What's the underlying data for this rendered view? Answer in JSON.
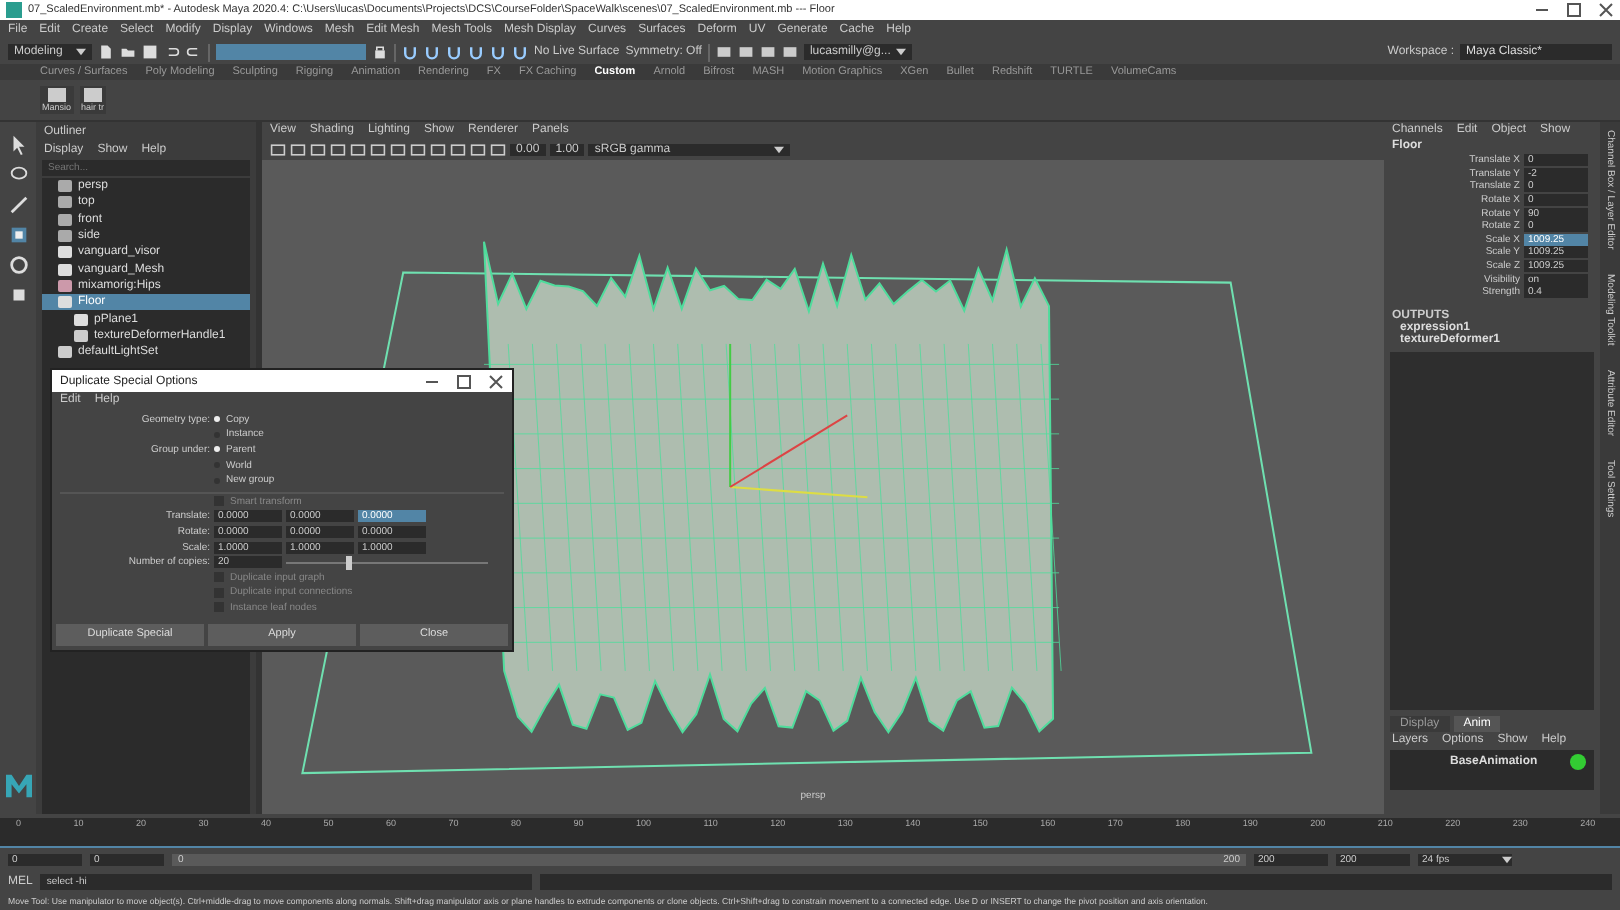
{
  "window": {
    "title": "07_ScaledEnvironment.mb* - Autodesk Maya 2020.4: C:\\Users\\lucas\\Documents\\Projects\\DCS\\CourseFolder\\SpaceWalk\\scenes\\07_ScaledEnvironment.mb --- Floor"
  },
  "menu_bar": [
    "File",
    "Edit",
    "Create",
    "Select",
    "Modify",
    "Display",
    "Windows",
    "Mesh",
    "Edit Mesh",
    "Mesh Tools",
    "Mesh Display",
    "Curves",
    "Surfaces",
    "Deform",
    "UV",
    "Generate",
    "Cache",
    "Help"
  ],
  "toolbar": {
    "mode": "Modeling",
    "live_surface": "No Live Surface",
    "symmetry": "Symmetry: Off",
    "account": "lucasmilly@g...",
    "workspace_label": "Workspace :",
    "workspace": "Maya Classic*"
  },
  "shelf_tabs": [
    {
      "label": "Curves / Surfaces",
      "selected": false
    },
    {
      "label": "Poly Modeling",
      "selected": false
    },
    {
      "label": "Sculpting",
      "selected": false
    },
    {
      "label": "Rigging",
      "selected": false
    },
    {
      "label": "Animation",
      "selected": false
    },
    {
      "label": "Rendering",
      "selected": false
    },
    {
      "label": "FX",
      "selected": false
    },
    {
      "label": "FX Caching",
      "selected": false
    },
    {
      "label": "Custom",
      "selected": true
    },
    {
      "label": "Arnold",
      "selected": false
    },
    {
      "label": "Bifrost",
      "selected": false
    },
    {
      "label": "MASH",
      "selected": false
    },
    {
      "label": "Motion Graphics",
      "selected": false
    },
    {
      "label": "XGen",
      "selected": false
    },
    {
      "label": "Bullet",
      "selected": false
    },
    {
      "label": "Redshift",
      "selected": false
    },
    {
      "label": "TURTLE",
      "selected": false
    },
    {
      "label": "VolumeCams",
      "selected": false
    }
  ],
  "shelf_items": [
    "Mansio",
    "hair tr"
  ],
  "outliner": {
    "title": "Outliner",
    "menu": [
      "Display",
      "Show",
      "Help"
    ],
    "search": {
      "placeholder": "Search..."
    },
    "items": [
      {
        "label": "persp",
        "kind": "camera",
        "selected": false
      },
      {
        "label": "top",
        "kind": "camera",
        "selected": false
      },
      {
        "label": "front",
        "kind": "camera",
        "selected": false
      },
      {
        "label": "side",
        "kind": "camera",
        "selected": false
      },
      {
        "label": "vanguard_visor",
        "kind": "mesh",
        "selected": false
      },
      {
        "label": "vanguard_Mesh",
        "kind": "mesh",
        "selected": false
      },
      {
        "label": "mixamorig:Hips",
        "kind": "joint",
        "selected": false
      },
      {
        "label": "Floor",
        "kind": "mesh",
        "selected": true,
        "children": [
          {
            "label": "pPlane1",
            "kind": "mesh",
            "selected": false
          },
          {
            "label": "textureDeformerHandle1",
            "kind": "deformer",
            "selected": false
          }
        ]
      },
      {
        "label": "defaultLightSet",
        "kind": "set",
        "selected": false
      }
    ]
  },
  "viewport": {
    "menu": [
      "View",
      "Shading",
      "Lighting",
      "Show",
      "Renderer",
      "Panels"
    ],
    "exposure": "0.00",
    "gamma": "1.00",
    "color_space": "sRGB gamma",
    "camera": "persp"
  },
  "channel_box": {
    "menu": [
      "Channels",
      "Edit",
      "Object",
      "Show"
    ],
    "object": "Floor",
    "attributes": [
      {
        "name": "Translate X",
        "value": "0",
        "selected": false
      },
      {
        "name": "Translate Y",
        "value": "-2",
        "selected": false
      },
      {
        "name": "Translate Z",
        "value": "0",
        "selected": false
      },
      {
        "name": "Rotate X",
        "value": "0",
        "selected": false
      },
      {
        "name": "Rotate Y",
        "value": "90",
        "selected": false
      },
      {
        "name": "Rotate Z",
        "value": "0",
        "selected": false
      },
      {
        "name": "Scale X",
        "value": "1009.25",
        "selected": true
      },
      {
        "name": "Scale Y",
        "value": "1009.25",
        "selected": false
      },
      {
        "name": "Scale Z",
        "value": "1009.25",
        "selected": false
      },
      {
        "name": "Visibility",
        "value": "on",
        "selected": false
      },
      {
        "name": "Strength",
        "value": "0.4",
        "selected": false
      }
    ],
    "outputs_title": "OUTPUTS",
    "outputs": [
      "expression1",
      "textureDeformer1"
    ]
  },
  "side_tabs": [
    "Channel Box / Layer Editor",
    "Modeling Toolkit",
    "Attribute Editor",
    "Tool Settings"
  ],
  "layer_editor": {
    "tabs": [
      {
        "label": "Display",
        "selected": false
      },
      {
        "label": "Anim",
        "selected": true
      }
    ],
    "menu": [
      "Layers",
      "Options",
      "Show",
      "Help"
    ],
    "layers": [
      {
        "name": "BaseAnimation",
        "active": true
      }
    ]
  },
  "dialog": {
    "title": "Duplicate Special Options",
    "menu": [
      "Edit",
      "Help"
    ],
    "geometry_type": {
      "label": "Geometry type:",
      "options": [
        {
          "label": "Copy",
          "selected": true
        },
        {
          "label": "Instance",
          "selected": false
        }
      ]
    },
    "group_under": {
      "label": "Group under:",
      "options": [
        {
          "label": "Parent",
          "selected": true
        },
        {
          "label": "World",
          "selected": false
        },
        {
          "label": "New group",
          "selected": false
        }
      ]
    },
    "smart_transform": {
      "label": "Smart transform",
      "checked": false
    },
    "vectors": [
      {
        "label": "Translate:",
        "values": [
          "0.0000",
          "0.0000",
          "0.0000"
        ]
      },
      {
        "label": "Rotate:",
        "values": [
          "0.0000",
          "0.0000",
          "0.0000"
        ]
      },
      {
        "label": "Scale:",
        "values": [
          "1.0000",
          "1.0000",
          "1.0000"
        ]
      }
    ],
    "copies": {
      "label": "Number of copies:",
      "value": "20",
      "level": 0.3
    },
    "options": [
      {
        "label": "Duplicate input graph",
        "checked": false
      },
      {
        "label": "Duplicate input connections",
        "checked": false
      },
      {
        "label": "Instance leaf nodes",
        "checked": false
      }
    ],
    "buttons": [
      "Duplicate Special",
      "Apply",
      "Close"
    ]
  },
  "timeline": {
    "ticks": [
      "0",
      "10",
      "20",
      "30",
      "40",
      "50",
      "60",
      "70",
      "80",
      "90",
      "100",
      "110",
      "120",
      "130",
      "140",
      "150",
      "160",
      "170",
      "180",
      "190",
      "200",
      "210",
      "220",
      "230",
      "240"
    ]
  },
  "range": {
    "level": 1,
    "start": "0",
    "inner_start": "0",
    "slider_start": "0",
    "slider_end": "200",
    "inner_end": "200",
    "end": "200",
    "fps": "24 fps"
  },
  "command_line": {
    "lang": "MEL",
    "value": "select -hi"
  },
  "help_line": "Move Tool: Use manipulator to move object(s). Ctrl+middle-drag to move components along normals. Shift+drag manipulator axis or plane handles to extrude components or clone objects. Ctrl+Shift+drag to constrain movement to a connected edge. Use D or INSERT to change the pivot position and axis orientation."
}
